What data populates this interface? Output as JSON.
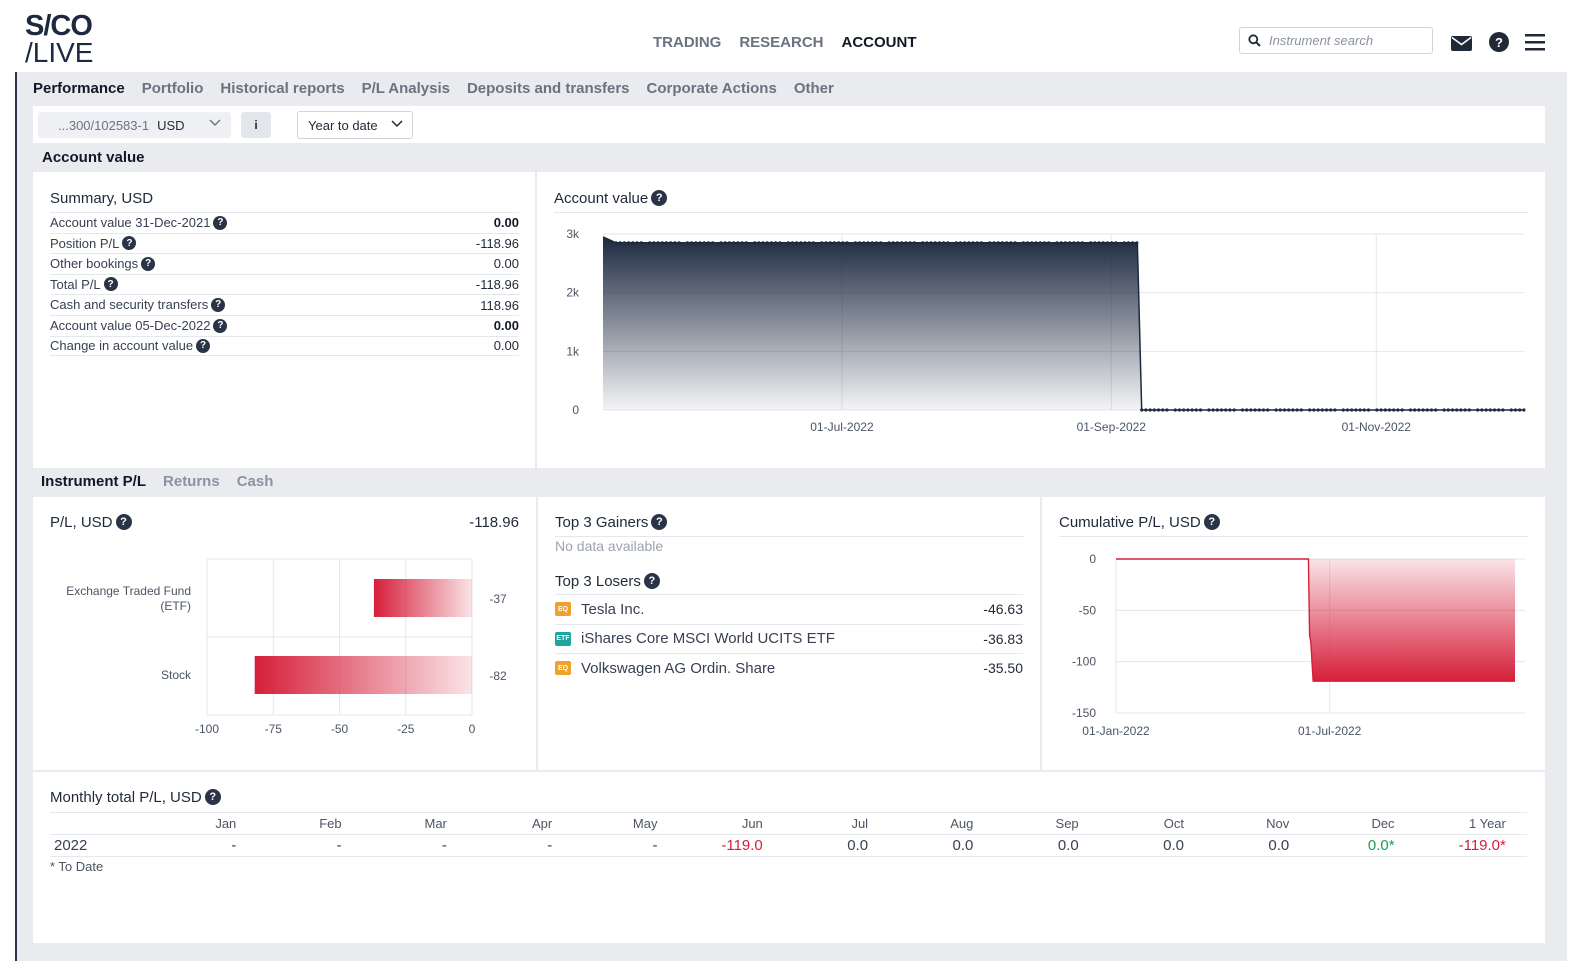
{
  "brand": {
    "line1": "S/CO",
    "line2": "/LIVE"
  },
  "main_nav": [
    "TRADING",
    "RESEARCH",
    "ACCOUNT"
  ],
  "main_nav_active": "ACCOUNT",
  "search": {
    "placeholder": "Instrument search"
  },
  "sub_nav": [
    "Performance",
    "Portfolio",
    "Historical reports",
    "P/L Analysis",
    "Deposits and transfers",
    "Corporate Actions",
    "Other"
  ],
  "sub_nav_active": "Performance",
  "filters": {
    "account": "...300/102583-1",
    "currency": "USD",
    "info": "i",
    "period": "Year to date"
  },
  "account_value_section": {
    "title": "Account value",
    "summary": {
      "title": "Summary, USD",
      "rows": [
        {
          "label": "Account value 31-Dec-2021",
          "value": "0.00",
          "bold": true
        },
        {
          "label": "Position P/L",
          "value": "-118.96",
          "bold": false
        },
        {
          "label": "Other bookings",
          "value": "0.00",
          "bold": false
        },
        {
          "label": "Total P/L",
          "value": "-118.96",
          "bold": false
        },
        {
          "label": "Cash and security transfers",
          "value": "118.96",
          "bold": false
        },
        {
          "label": "Account value 05-Dec-2022",
          "value": "0.00",
          "bold": true
        },
        {
          "label": "Change in account value",
          "value": "0.00",
          "bold": false
        }
      ]
    }
  },
  "tabs2": [
    "Instrument P/L",
    "Returns",
    "Cash"
  ],
  "tabs2_active": "Instrument P/L",
  "pl_panel": {
    "title": "P/L, USD",
    "total": "-118.96"
  },
  "gainers": {
    "title": "Top 3 Gainers",
    "empty": "No data available"
  },
  "losers": {
    "title": "Top 3 Losers",
    "items": [
      {
        "badge": "EQ",
        "color": "#f0a02b",
        "name": "Tesla Inc.",
        "value": "-46.63"
      },
      {
        "badge": "ETF",
        "color": "#1fa5a0",
        "name": "iShares Core MSCI World UCITS ETF",
        "value": "-36.83"
      },
      {
        "badge": "EQ",
        "color": "#f0a02b",
        "name": "Volkswagen AG Ordin. Share",
        "value": "-35.50"
      }
    ]
  },
  "monthly": {
    "title": "Monthly total P/L, USD",
    "columns": [
      "Jan",
      "Feb",
      "Mar",
      "Apr",
      "May",
      "Jun",
      "Jul",
      "Aug",
      "Sep",
      "Oct",
      "Nov",
      "Dec",
      "1 Year"
    ],
    "rows": [
      {
        "year": "2022",
        "values": [
          "-",
          "-",
          "-",
          "-",
          "-",
          "-119.0",
          "0.0",
          "0.0",
          "0.0",
          "0.0",
          "0.0",
          "0.0*",
          "-119.0*"
        ],
        "tone": [
          "",
          "",
          "",
          "",
          "",
          "neg",
          "",
          "",
          "",
          "",
          "",
          "pos",
          "neg"
        ]
      }
    ],
    "footnote": "* To Date"
  },
  "colors": {
    "navy": "#1d2940",
    "red": "#d61f3a",
    "green": "#18a058"
  },
  "chart_data": [
    {
      "type": "area",
      "title": "Account value",
      "x_ticks": [
        "01-Jul-2022",
        "01-Sep-2022",
        "01-Nov-2022"
      ],
      "y_ticks": [
        "0",
        "1k",
        "2k",
        "3k"
      ],
      "ylim": [
        0,
        3000
      ],
      "xlim": [
        "2022-05-07",
        "2022-12-05"
      ],
      "points": [
        {
          "x": "2022-05-07",
          "y": 2950
        },
        {
          "x": "2022-05-10",
          "y": 2850
        },
        {
          "x": "2022-09-07",
          "y": 2850
        },
        {
          "x": "2022-09-08",
          "y": 0
        },
        {
          "x": "2022-12-05",
          "y": 0
        }
      ],
      "grid": true
    },
    {
      "type": "bar",
      "orientation": "horizontal",
      "categories": [
        "Exchange Traded Fund (ETF)",
        "Stock"
      ],
      "values": [
        -37,
        -82
      ],
      "data_labels": [
        "-37",
        "-82"
      ],
      "x_ticks": [
        "-100",
        "-75",
        "-50",
        "-25",
        "0"
      ],
      "xlim": [
        -100,
        0
      ],
      "grid": true
    },
    {
      "type": "area",
      "title": "Cumulative P/L, USD",
      "x_ticks": [
        "01-Jan-2022",
        "01-Jul-2022"
      ],
      "y_ticks": [
        "0",
        "-50",
        "-100",
        "-150"
      ],
      "ylim": [
        -150,
        0
      ],
      "xlim": [
        "2022-01-01",
        "2022-12-05"
      ],
      "points": [
        {
          "x": "2022-01-01",
          "y": 0
        },
        {
          "x": "2022-06-13",
          "y": 0
        },
        {
          "x": "2022-06-14",
          "y": -75
        },
        {
          "x": "2022-06-15",
          "y": -80
        },
        {
          "x": "2022-06-17",
          "y": -119
        },
        {
          "x": "2022-12-05",
          "y": -119
        }
      ],
      "grid": true
    }
  ]
}
